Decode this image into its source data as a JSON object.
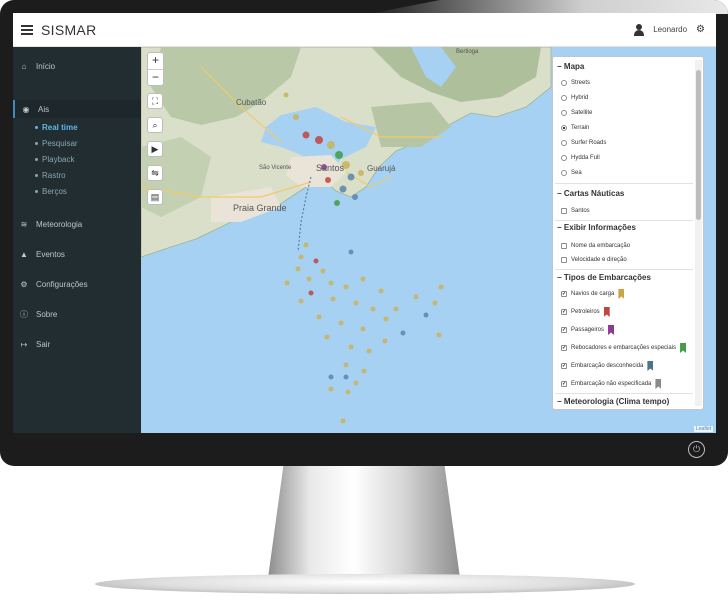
{
  "app": {
    "title": "SISMAR"
  },
  "header": {
    "user_name": "Leonardo"
  },
  "sidebar": {
    "items": [
      {
        "label": "Início",
        "icon": "home-icon"
      },
      {
        "label": "Ais",
        "icon": "map-marker-icon"
      },
      {
        "label": "Meteorologia",
        "icon": "wind-icon"
      },
      {
        "label": "Eventos",
        "icon": "bell-icon"
      },
      {
        "label": "Configurações",
        "icon": "gear-icon"
      },
      {
        "label": "Sobre",
        "icon": "info-icon"
      },
      {
        "label": "Sair",
        "icon": "sign-out-icon"
      }
    ],
    "ais_subitems": [
      {
        "label": "Real time",
        "active": true
      },
      {
        "label": "Pesquisar"
      },
      {
        "label": "Playback"
      },
      {
        "label": "Rastro"
      },
      {
        "label": "Berços"
      }
    ]
  },
  "map": {
    "attribution": "Leaflet",
    "zoom_in": "+",
    "zoom_out": "−",
    "place_labels": [
      "Cubatão",
      "Santos",
      "Guarujá",
      "Praia Grande",
      "São Vicente",
      "Bertioga"
    ]
  },
  "layer_control": {
    "mapa": {
      "title": "Mapa",
      "options": [
        "Streets",
        "Hybrid",
        "Satellite",
        "Terrain",
        "Surfer Roads",
        "Hydda Full",
        "Sea"
      ],
      "selected": "Terrain"
    },
    "cartas": {
      "title": "Cartas Náuticas",
      "options": [
        {
          "label": "Santos",
          "checked": false
        }
      ]
    },
    "exibir": {
      "title": "Exibir Informações",
      "options": [
        {
          "label": "Nome da embarcação",
          "checked": false
        },
        {
          "label": "Velocidade e direção",
          "checked": false
        }
      ]
    },
    "tipos": {
      "title": "Tipos de Embarcações",
      "options": [
        {
          "label": "Navios de carga",
          "checked": true,
          "color": "#c9a544"
        },
        {
          "label": "Petroleiros",
          "checked": true,
          "color": "#c0463f"
        },
        {
          "label": "Passageiros",
          "checked": true,
          "color": "#8e3a93"
        },
        {
          "label": "Rebocadores e embarcações especiais",
          "checked": true,
          "color": "#3f9e46"
        },
        {
          "label": "Embarcação desconhecida",
          "checked": true,
          "color": "#4d7289"
        },
        {
          "label": "Embarcação não especificada",
          "checked": true,
          "color": "#8a8a8a"
        }
      ]
    },
    "meteorologia": {
      "title": "Meteorologia (Clima tempo)"
    }
  },
  "colors": {
    "sidebar_bg": "#222d32",
    "accent": "#3c8dbc",
    "sea": "#a6d1f2",
    "vessel_cargo": "#c9b35b",
    "vessel_tanker": "#c0463f",
    "vessel_passenger": "#8e3a93",
    "vessel_tug": "#3f9e46",
    "vessel_unknown": "#5b86ad",
    "vessel_unspecified": "#a7a7a7"
  }
}
